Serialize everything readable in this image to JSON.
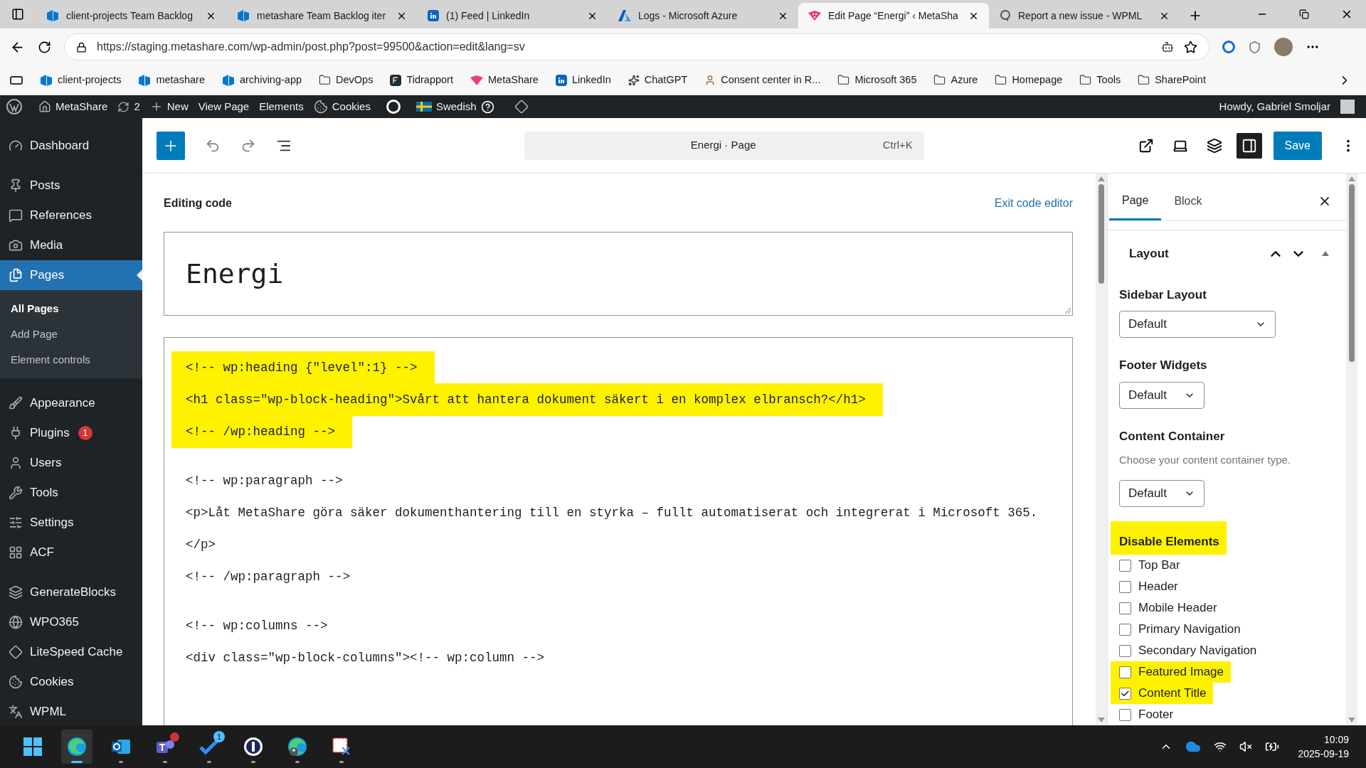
{
  "browser": {
    "tabs": [
      {
        "title": "client-projects Team Backlog",
        "selected": false
      },
      {
        "title": "metashare Team Backlog iter",
        "selected": false
      },
      {
        "title": "(1) Feed | LinkedIn",
        "selected": false
      },
      {
        "title": "Logs - Microsoft Azure",
        "selected": false
      },
      {
        "title": "Edit Page “Energi” ‹ MetaSha",
        "selected": true
      },
      {
        "title": "Report a new issue - WPML",
        "selected": false
      }
    ],
    "url": "https://staging.metashare.com/wp-admin/post.php?post=99500&action=edit&lang=sv",
    "bookmarks": [
      {
        "label": "client-projects",
        "kind": "devops"
      },
      {
        "label": "metashare",
        "kind": "devops"
      },
      {
        "label": "archiving-app",
        "kind": "devops"
      },
      {
        "label": "DevOps",
        "kind": "folder"
      },
      {
        "label": "Tidrapport",
        "kind": "app"
      },
      {
        "label": "MetaShare",
        "kind": "brand"
      },
      {
        "label": "LinkedIn",
        "kind": "linkedin"
      },
      {
        "label": "ChatGPT",
        "kind": "chatgpt"
      },
      {
        "label": "Consent center in R...",
        "kind": "person"
      },
      {
        "label": "Microsoft 365",
        "kind": "folder"
      },
      {
        "label": "Azure",
        "kind": "folder"
      },
      {
        "label": "Homepage",
        "kind": "folder"
      },
      {
        "label": "Tools",
        "kind": "folder"
      },
      {
        "label": "SharePoint",
        "kind": "folder"
      }
    ]
  },
  "admin_bar": {
    "site": "MetaShare",
    "updates": "2",
    "new": "New",
    "view": "View Page",
    "elements": "Elements",
    "cookies": "Cookies",
    "language": "Swedish",
    "greeting": "Howdy, Gabriel Smoljar"
  },
  "admin_menu": [
    {
      "label": "Dashboard",
      "selected": false
    },
    {
      "label": "Posts",
      "selected": false
    },
    {
      "label": "References",
      "selected": false
    },
    {
      "label": "Media",
      "selected": false
    },
    {
      "label": "Pages",
      "selected": true,
      "children": [
        {
          "label": "All Pages",
          "selected": true
        },
        {
          "label": "Add Page",
          "selected": false
        },
        {
          "label": "Element controls",
          "selected": false
        }
      ]
    },
    {
      "label": "Appearance",
      "selected": false
    },
    {
      "label": "Plugins",
      "selected": false,
      "badge": "1"
    },
    {
      "label": "Users",
      "selected": false
    },
    {
      "label": "Tools",
      "selected": false
    },
    {
      "label": "Settings",
      "selected": false
    },
    {
      "label": "ACF",
      "selected": false
    },
    {
      "label": "GenerateBlocks",
      "selected": false
    },
    {
      "label": "WPO365",
      "selected": false
    },
    {
      "label": "LiteSpeed Cache",
      "selected": false
    },
    {
      "label": "Cookies",
      "selected": false
    },
    {
      "label": "WPML",
      "selected": false
    }
  ],
  "editor_header": {
    "document": "Energi · Page",
    "shortcut": "Ctrl+K",
    "save": "Save"
  },
  "editor": {
    "heading": "Editing code",
    "exit": "Exit code editor",
    "title": "Energi",
    "code_blocks": [
      [
        {
          "text": "<!-- wp:heading {\"level\":1} -->",
          "highlighted": true
        },
        {
          "text": "<h1 class=\"wp-block-heading\">Svårt att hantera dokument säkert i en komplex elbransch?</h1>",
          "highlighted": true
        },
        {
          "text": "<!-- /wp:heading -->",
          "highlighted": true
        }
      ],
      [
        {
          "text": "<!-- wp:paragraph -->",
          "highlighted": false
        },
        {
          "text": "<p>Låt MetaShare göra säker dokumenthantering till en styrka – fullt automatiserat och integrerat i Microsoft 365.",
          "highlighted": false
        },
        {
          "text": "</p>",
          "highlighted": false
        },
        {
          "text": "<!-- /wp:paragraph -->",
          "highlighted": false
        }
      ],
      [
        {
          "text": "<!-- wp:columns -->",
          "highlighted": false
        },
        {
          "text": "<div class=\"wp-block-columns\"><!-- wp:column -->",
          "highlighted": false
        }
      ]
    ]
  },
  "settings": {
    "tabs": [
      {
        "label": "Page",
        "selected": true
      },
      {
        "label": "Block",
        "selected": false
      }
    ],
    "panel": "Layout",
    "fields": [
      {
        "label": "Sidebar Layout",
        "value": "Default",
        "wide": true
      },
      {
        "label": "Footer Widgets",
        "value": "Default",
        "wide": false
      },
      {
        "label": "Content Container",
        "help": "Choose your content container type.",
        "value": "Default",
        "wide": false
      }
    ],
    "disable": {
      "title": "Disable Elements",
      "highlighted": true,
      "items": [
        {
          "label": "Top Bar",
          "checked": false,
          "highlighted": false
        },
        {
          "label": "Header",
          "checked": false,
          "highlighted": false
        },
        {
          "label": "Mobile Header",
          "checked": false,
          "highlighted": false
        },
        {
          "label": "Primary Navigation",
          "checked": false,
          "highlighted": false
        },
        {
          "label": "Secondary Navigation",
          "checked": false,
          "highlighted": false
        },
        {
          "label": "Featured Image",
          "checked": false,
          "highlighted": true
        },
        {
          "label": "Content Title",
          "checked": true,
          "highlighted": true
        },
        {
          "label": "Footer",
          "checked": false,
          "highlighted": false
        }
      ]
    }
  },
  "taskbar": {
    "apps": [
      {
        "active": false
      },
      {
        "active": true
      },
      {
        "active": false
      },
      {
        "active": false,
        "badge": true
      },
      {
        "active": false,
        "badge": "1"
      },
      {
        "active": false
      },
      {
        "active": false
      },
      {
        "active": false
      }
    ],
    "time": "10:09",
    "date": "2025-09-19"
  }
}
